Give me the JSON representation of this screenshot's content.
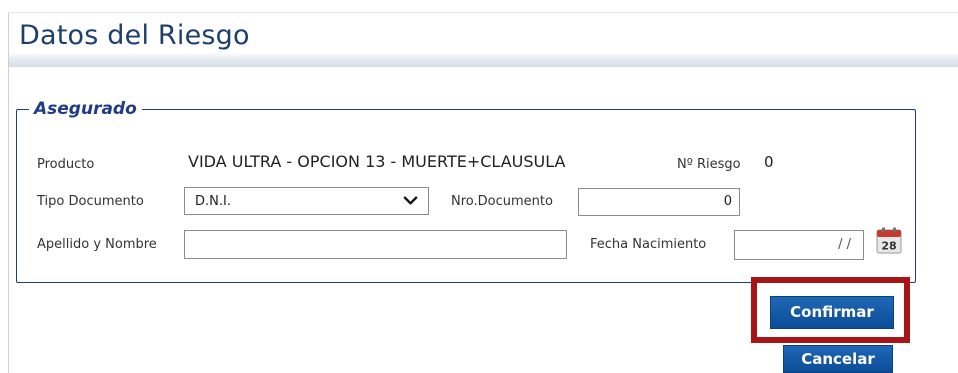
{
  "page": {
    "title": "Datos del Riesgo"
  },
  "asegurado": {
    "legend": "Asegurado",
    "producto_label": "Producto",
    "producto_value": "VIDA ULTRA - OPCION 13 - MUERTE+CLAUSULA",
    "riesgo_label": "Nº Riesgo",
    "riesgo_value": "0",
    "tipo_documento_label": "Tipo Documento",
    "tipo_documento_value": "D.N.I.",
    "nro_documento_label": "Nro.Documento",
    "nro_documento_value": "0",
    "apellido_nombre_label": "Apellido y Nombre",
    "apellido_nombre_value": "",
    "fecha_nacimiento_label": "Fecha Nacimiento",
    "fecha_nacimiento_value": "/ /",
    "calendar_day": "28"
  },
  "actions": {
    "confirm_label": "Confirmar",
    "cancel_label": "Cancelar"
  },
  "colors": {
    "title": "#1d3f6e",
    "legend": "#213a8a",
    "button": "#0c4d98",
    "highlight": "#a81516"
  }
}
